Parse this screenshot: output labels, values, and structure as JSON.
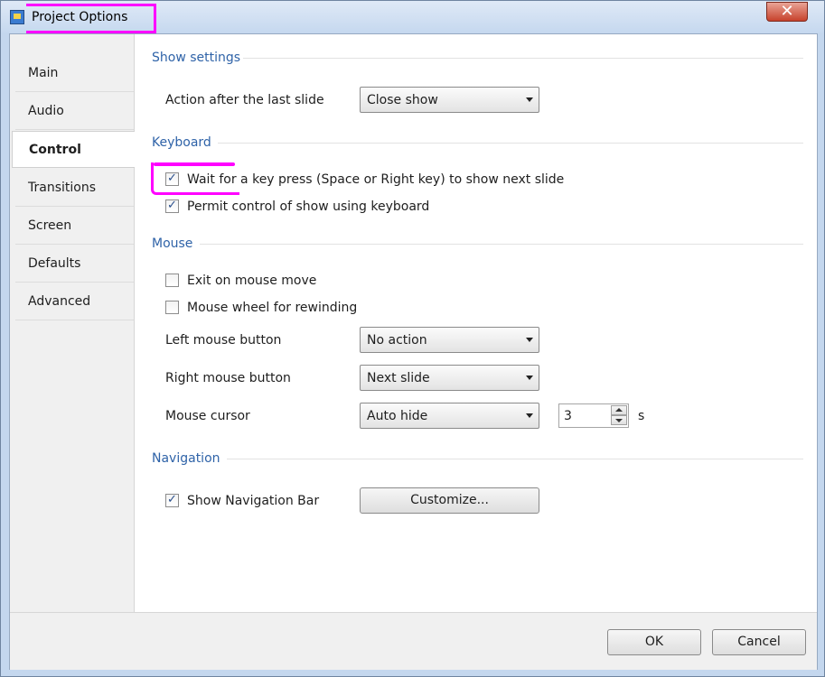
{
  "window": {
    "title": "Project Options",
    "close_label": "✕"
  },
  "sidebar": {
    "items": [
      {
        "label": "Main"
      },
      {
        "label": "Audio"
      },
      {
        "label": "Control"
      },
      {
        "label": "Transitions"
      },
      {
        "label": "Screen"
      },
      {
        "label": "Defaults"
      },
      {
        "label": "Advanced"
      }
    ],
    "active": "Control"
  },
  "show_settings": {
    "title": "Show settings",
    "action_label": "Action after the last slide",
    "action_value": "Close show"
  },
  "keyboard": {
    "title": "Keyboard",
    "wait_keypress": {
      "label": "Wait for a key press (Space or Right key) to show next slide",
      "checked": true
    },
    "permit_control": {
      "label": "Permit control of show using keyboard",
      "checked": true
    }
  },
  "mouse": {
    "title": "Mouse",
    "exit_on_move": {
      "label": "Exit on mouse move",
      "checked": false
    },
    "wheel_rewind": {
      "label": "Mouse wheel for rewinding",
      "checked": false
    },
    "left_button_label": "Left mouse button",
    "left_button_value": "No action",
    "right_button_label": "Right mouse button",
    "right_button_value": "Next slide",
    "cursor_label": "Mouse cursor",
    "cursor_value": "Auto hide",
    "cursor_delay": "3",
    "cursor_unit": "s"
  },
  "navigation": {
    "title": "Navigation",
    "show_bar": {
      "label": "Show Navigation Bar",
      "checked": true
    },
    "customize_label": "Customize..."
  },
  "footer": {
    "ok_label": "OK",
    "cancel_label": "Cancel"
  },
  "icons": {
    "app": "app-icon",
    "check": "checkmark-icon",
    "dropdown": "dropdown-arrow-icon"
  },
  "colors": {
    "section_title": "#2f63a8",
    "highlight": "#ff00ff",
    "close_button": "#c7422c"
  }
}
